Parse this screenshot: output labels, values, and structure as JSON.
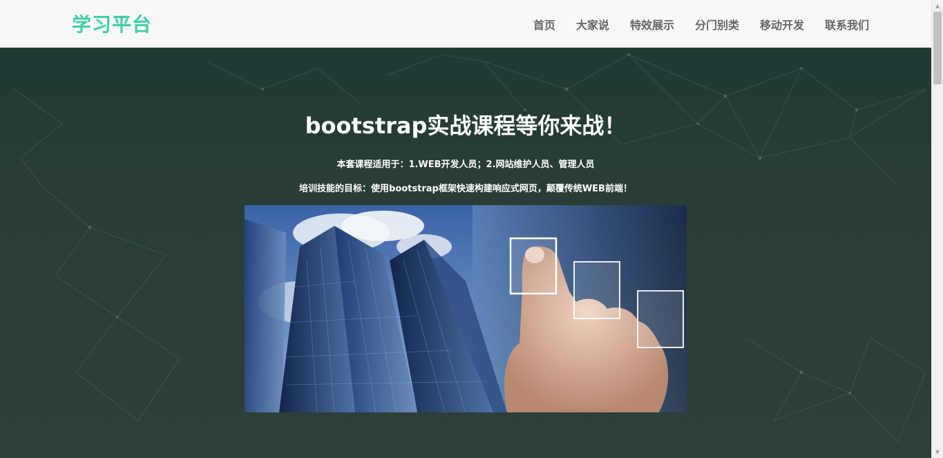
{
  "navbar": {
    "brand": "学习平台",
    "items": [
      {
        "label": "首页"
      },
      {
        "label": "大家说"
      },
      {
        "label": "特效展示"
      },
      {
        "label": "分门别类"
      },
      {
        "label": "移动开发"
      },
      {
        "label": "联系我们"
      }
    ]
  },
  "hero": {
    "title": "bootstrap实战课程等你来战！",
    "line1": "本套课程适用于：1.WEB开发人员；2.网站维护人员、管理人员",
    "line2": "培训技能的目标：使用bootstrap框架快速构建响应式网页，颠覆传统WEB前端！"
  },
  "scrollbar": {
    "up_icon": "scroll-up-arrow-icon",
    "down_icon": "scroll-down-arrow-icon",
    "up_glyph": "▲",
    "down_glyph": "▼"
  },
  "colors": {
    "brand": "#3fcfa8",
    "nav_text": "#666666",
    "navbar_bg": "#f8f8f8",
    "hero_bg": "#2d3f38"
  }
}
